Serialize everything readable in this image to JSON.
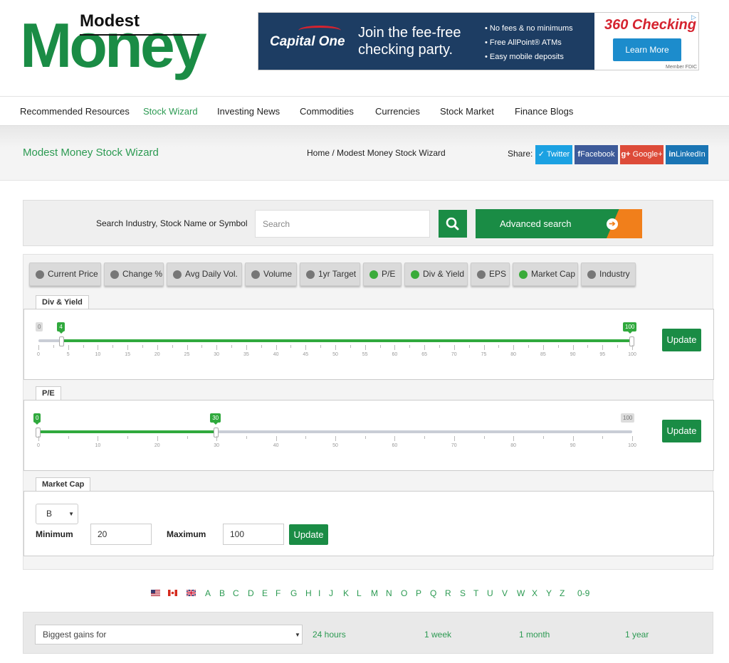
{
  "logo": {
    "top_word": "Modest",
    "main_word": "Money"
  },
  "ad": {
    "brand": "Capital One",
    "headline": "Join the fee-free checking party.",
    "bullets": [
      "• No fees & no minimums",
      "• Free AllPoint® ATMs",
      "• Easy mobile deposits"
    ],
    "product": "360 Checking",
    "cta": "Learn More",
    "fine_print": "Member FDIC"
  },
  "nav": {
    "items": [
      "Recommended Resources",
      "Stock Wizard",
      "Investing News",
      "Commodities",
      "Currencies",
      "Stock Market",
      "Finance Blogs"
    ],
    "active": "Stock Wizard"
  },
  "banner": {
    "title": "Modest Money Stock Wizard",
    "breadcrumb": "Home / Modest Money Stock Wizard",
    "share_label": "Share:",
    "share": [
      {
        "label": "Twitter",
        "icon": "twitter-icon",
        "color": "#1ba1e2"
      },
      {
        "label": "Facebook",
        "icon": "facebook-icon",
        "color": "#3d5a99"
      },
      {
        "label": "Google+",
        "icon": "google-plus-icon",
        "color": "#dd4b39"
      },
      {
        "label": "LinkedIn",
        "icon": "linkedin-icon",
        "color": "#1a75b4"
      }
    ]
  },
  "search": {
    "label": "Search Industry, Stock Name or Symbol",
    "placeholder": "Search",
    "advanced": "Advanced search"
  },
  "filters": {
    "tabs": [
      {
        "label": "Current Price",
        "on": false
      },
      {
        "label": "Change %",
        "on": false
      },
      {
        "label": "Avg Daily Vol.",
        "on": false
      },
      {
        "label": "Volume",
        "on": false
      },
      {
        "label": "1yr Target",
        "on": false
      },
      {
        "label": "P/E",
        "on": true
      },
      {
        "label": "Div & Yield",
        "on": true
      },
      {
        "label": "EPS",
        "on": false
      },
      {
        "label": "Market Cap",
        "on": true
      },
      {
        "label": "Industry",
        "on": false
      }
    ],
    "div_yield": {
      "label": "Div & Yield",
      "min": 0,
      "max": 100,
      "low": 4,
      "high": 100,
      "tick_labels": [
        "0",
        "5",
        "10",
        "15",
        "20",
        "25",
        "30",
        "35",
        "40",
        "45",
        "50",
        "55",
        "60",
        "65",
        "70",
        "75",
        "80",
        "85",
        "90",
        "95",
        "100"
      ],
      "update": "Update"
    },
    "pe": {
      "label": "P/E",
      "min": 0,
      "max": 100,
      "low": 0,
      "high": 30,
      "tick_labels": [
        "0",
        "10",
        "20",
        "30",
        "40",
        "50",
        "60",
        "70",
        "80",
        "90",
        "100"
      ],
      "update": "Update"
    },
    "market_cap": {
      "label": "Market Cap",
      "unit": "B",
      "min_label": "Minimum",
      "min_value": "20",
      "max_label": "Maximum",
      "max_value": "100",
      "update": "Update"
    }
  },
  "alphabet": {
    "flags": [
      "us-flag-icon",
      "canada-flag-icon",
      "uk-flag-icon"
    ],
    "letters": [
      "A",
      "B",
      "C",
      "D",
      "E",
      "F",
      "G",
      "H",
      "I",
      "J",
      "K",
      "L",
      "M",
      "N",
      "O",
      "P",
      "Q",
      "R",
      "S",
      "T",
      "U",
      "V",
      "W",
      "X",
      "Y",
      "Z",
      "0-9"
    ]
  },
  "gains": {
    "select": "Biggest gains for",
    "periods": [
      "24 hours",
      "1 week",
      "1 month",
      "1 year"
    ]
  }
}
